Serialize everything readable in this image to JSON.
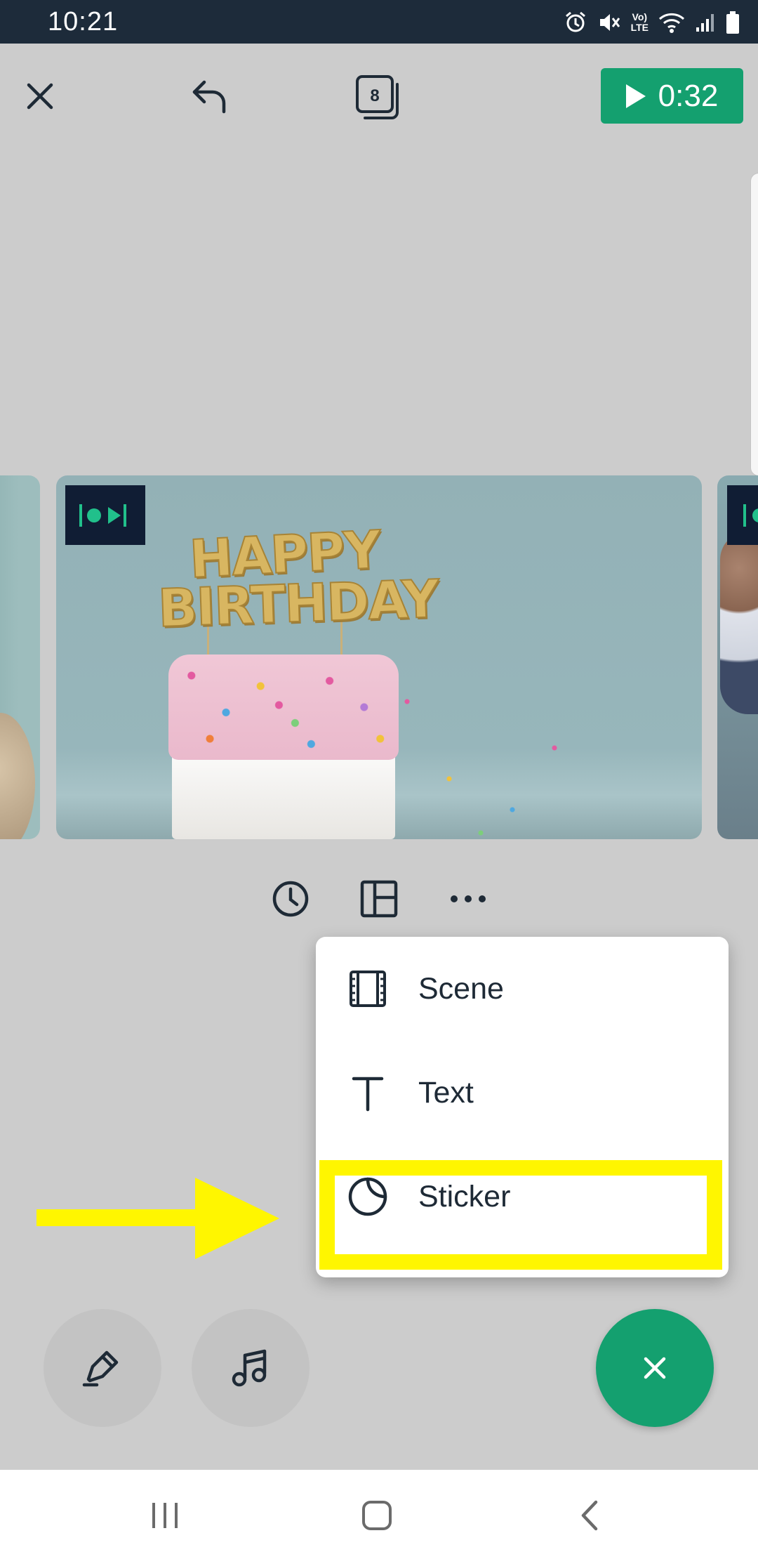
{
  "status_bar": {
    "time": "10:21",
    "volte_label": "Vo)\nLTE",
    "icons": [
      "alarm-icon",
      "mute-icon",
      "volte-icon",
      "wifi-icon",
      "signal-icon",
      "battery-icon"
    ]
  },
  "toolbar": {
    "close_icon": "close-icon",
    "undo_icon": "undo-icon",
    "scenes_count": "8",
    "play_time": "0:32"
  },
  "filmstrip": {
    "selected_clip_text_line1": "HAPPY",
    "selected_clip_text_line2": "BIRTHDAY"
  },
  "clip_controls": [
    "clock-icon",
    "layout-icon",
    "more-icon"
  ],
  "add_menu": {
    "items": [
      {
        "label": "Scene",
        "icon": "film-icon"
      },
      {
        "label": "Text",
        "icon": "text-icon"
      },
      {
        "label": "Sticker",
        "icon": "sticker-icon"
      }
    ],
    "highlighted_item": "Sticker",
    "highlight_color": "#fff600"
  },
  "colors": {
    "accent": "#14a06f",
    "status_bar": "#1d2b3a",
    "background": "#cccccc"
  }
}
